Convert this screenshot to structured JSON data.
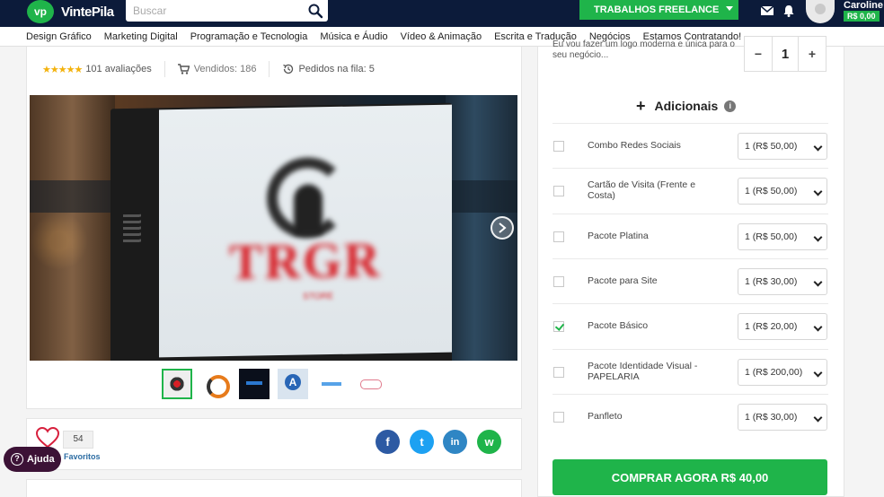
{
  "header": {
    "logo_badge": "vp",
    "logo_text": "VintePila",
    "search_placeholder": "Buscar",
    "freelance_button": "TRABALHOS FREELANCE",
    "user_name": "Caroline",
    "balance": "R$ 0,00"
  },
  "categories": [
    "Design Gráfico",
    "Marketing Digital",
    "Programação e Tecnologia",
    "Música e Áudio",
    "Vídeo & Animação",
    "Escrita e Tradução",
    "Negócios",
    "Estamos Contratando!"
  ],
  "service": {
    "stars": "★★★★★",
    "reviews": "101 avaliações",
    "sold": "Vendidos: 186",
    "queue": "Pedidos na fila: 5",
    "image_text": "TRGR",
    "image_subtext": "STORE",
    "favorites_count": "54",
    "favorites_label": "Favoritos"
  },
  "share": {
    "facebook": "f",
    "twitter": "t",
    "linkedin": "in",
    "whatsapp": "w"
  },
  "help_label": "Ajuda",
  "order": {
    "description": "Eu vou fazer um logo moderna e única para o seu negócio...",
    "quantity": "1",
    "minus": "−",
    "plus": "+",
    "addons_title": "Adicionais",
    "addons": [
      {
        "name": "Combo Redes Sociais",
        "option": "1 (R$ 50,00)",
        "checked": false
      },
      {
        "name": "Cartão de Visita (Frente e Costa)",
        "option": "1 (R$ 50,00)",
        "checked": false
      },
      {
        "name": "Pacote Platina",
        "option": "1 (R$ 50,00)",
        "checked": false
      },
      {
        "name": "Pacote para Site",
        "option": "1 (R$ 30,00)",
        "checked": false
      },
      {
        "name": "Pacote Básico",
        "option": "1 (R$ 20,00)",
        "checked": true
      },
      {
        "name": "Pacote Identidade Visual - PAPELARIA",
        "option": "1 (R$ 200,00)",
        "checked": false
      },
      {
        "name": "Panfleto",
        "option": "1 (R$ 30,00)",
        "checked": false
      }
    ],
    "buy_button": "COMPRAR AGORA R$ 40,00"
  },
  "colors": {
    "topbar": "#0c1b3a",
    "brand_green": "#1fb44a",
    "star": "#f3b20c",
    "help": "#3c1236"
  }
}
